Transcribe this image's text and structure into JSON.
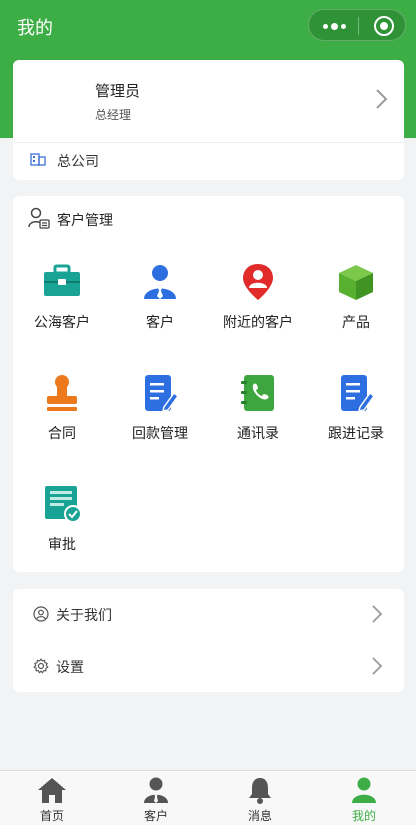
{
  "header": {
    "title": "我的"
  },
  "profile": {
    "name": "管理员",
    "role": "总经理",
    "company": "总公司"
  },
  "customer_menu": {
    "title": "客户管理",
    "items": [
      {
        "label": "公海客户",
        "icon": "briefcase-icon",
        "color": "#19a394"
      },
      {
        "label": "客户",
        "icon": "person-icon",
        "color": "#2d6ee0"
      },
      {
        "label": "附近的客户",
        "icon": "location-pin-icon",
        "color": "#e12a2a"
      },
      {
        "label": "产品",
        "icon": "box-icon",
        "color": "#58b030"
      },
      {
        "label": "合同",
        "icon": "stamp-icon",
        "color": "#ec7a1c"
      },
      {
        "label": "回款管理",
        "icon": "document-edit-icon",
        "color": "#2d6ee0"
      },
      {
        "label": "通讯录",
        "icon": "phone-book-icon",
        "color": "#3ea63e"
      },
      {
        "label": "跟进记录",
        "icon": "document-edit-icon",
        "color": "#2d6ee0"
      },
      {
        "label": "审批",
        "icon": "approval-icon",
        "color": "#19a394"
      }
    ]
  },
  "settings": {
    "items": [
      {
        "label": "关于我们",
        "icon": "user-circle-icon"
      },
      {
        "label": "设置",
        "icon": "gear-icon"
      }
    ]
  },
  "tabbar": {
    "items": [
      {
        "label": "首页",
        "icon": "home-icon"
      },
      {
        "label": "客户",
        "icon": "customer-icon"
      },
      {
        "label": "消息",
        "icon": "bell-icon"
      },
      {
        "label": "我的",
        "icon": "me-icon"
      }
    ],
    "active_index": 3
  },
  "colors": {
    "primary": "#3dae45"
  }
}
